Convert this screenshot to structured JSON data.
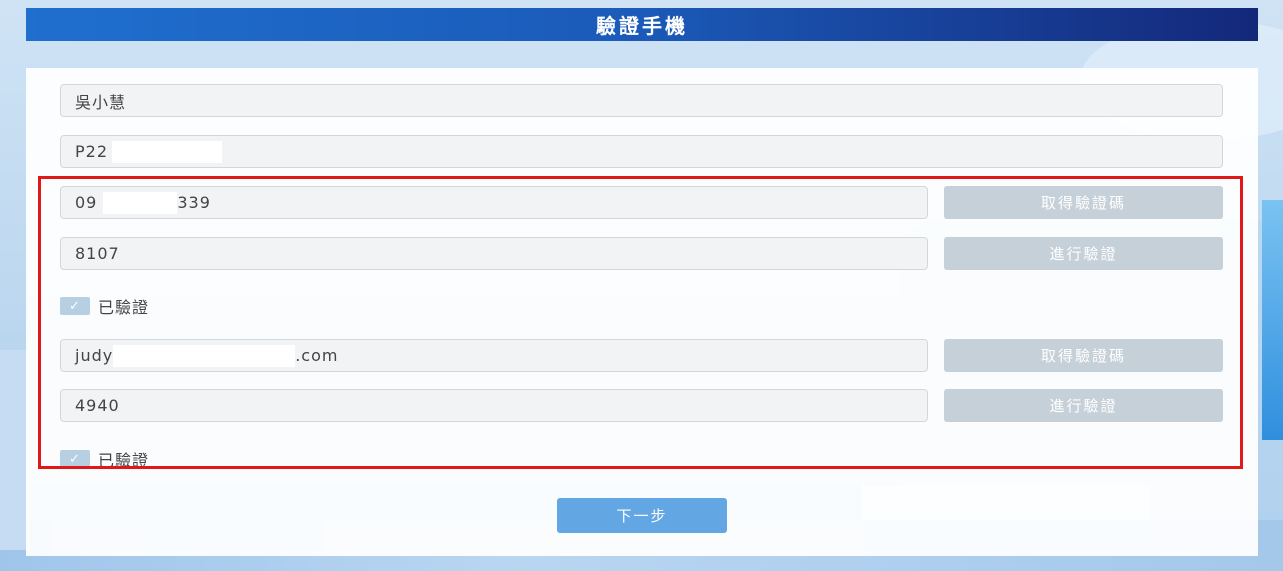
{
  "header": {
    "title": "驗證手機"
  },
  "form": {
    "name_value": "吳小慧",
    "id_prefix": "P22",
    "phone_prefix": "09",
    "phone_suffix": "339",
    "phone_code": "8107",
    "email_prefix": "judy",
    "email_suffix": ".com",
    "email_code": "4940",
    "get_code_label": "取得驗證碼",
    "verify_label": "進行驗證",
    "verified_label": "已驗證",
    "email_get_code_label": "取得驗證碼",
    "email_verify_label": "進行驗證",
    "email_verified_label": "已驗證"
  },
  "footer": {
    "next_label": "下一步"
  },
  "colors": {
    "header_start": "#1f6fcf",
    "header_end": "#14287a",
    "highlight": "#e01818",
    "next_button": "#62a6e3",
    "disabled_button": "#c5d0d9"
  }
}
